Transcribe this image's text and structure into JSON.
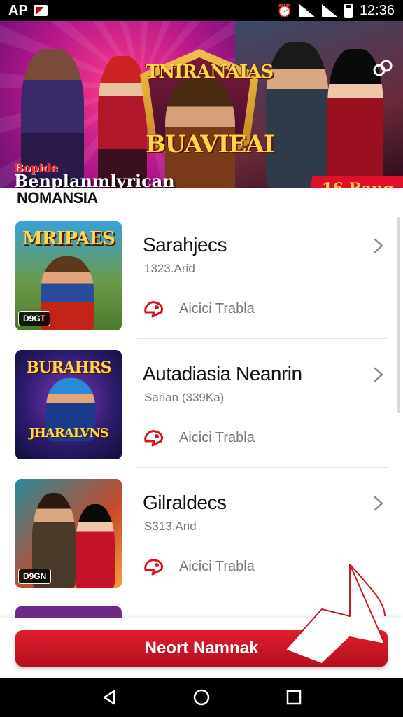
{
  "status_bar": {
    "carrier": "AP",
    "time": "12:36"
  },
  "banner": {
    "title_top": "TNIRANAIAS",
    "title_bottom": "BUAVIEAI",
    "subtitle_small": "Bopide",
    "subtitle_large": "Benplanmlyrican",
    "badge": "16 Bauq"
  },
  "section": {
    "title": "NOMANSIA"
  },
  "items": [
    {
      "thumb_title": "MRIPAES",
      "thumb_badge": "D9GT",
      "title": "Sarahjecs",
      "subtitle": "1323.Arid",
      "action": "Aicici Trabla"
    },
    {
      "thumb_title": "BURAHRS",
      "thumb_title2": "JHARALVNS",
      "title": "Autadiasia Neanrin",
      "subtitle": "Sarian (339Ka)",
      "action": "Aicici Trabla"
    },
    {
      "thumb_badge": "D9GN",
      "title": "Gilraldecs",
      "subtitle": "S313.Arid",
      "action": "Aicici Trabla"
    }
  ],
  "cta": {
    "label": "Neort Namnak"
  },
  "colors": {
    "accent": "#d6141f",
    "text_primary": "#111111",
    "text_secondary": "#777777"
  },
  "icons": {
    "tag": "tag-icon",
    "chevron": "chevron-right-icon",
    "back": "back-icon",
    "home": "home-icon",
    "recents": "recents-icon"
  }
}
